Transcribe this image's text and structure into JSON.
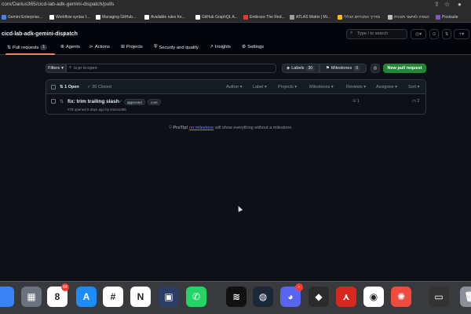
{
  "browser": {
    "url": "com/Darius365/cicd-lab-adk-gemini-dispatch/pulls",
    "bookmarks": [
      {
        "label": "Gemini Enterprise...",
        "color": "#4285f4"
      },
      {
        "label": "Workflow syntax f...",
        "color": "#ffffff"
      },
      {
        "label": "Managing GitHub...",
        "color": "#ffffff"
      },
      {
        "label": "Available rules for...",
        "color": "#ffffff"
      },
      {
        "label": "GitHub GraphQL A...",
        "color": "#ffffff"
      },
      {
        "label": "Embrace The Red...",
        "color": "#e53935"
      },
      {
        "label": "ATLAS Matrix | Mi...",
        "color": "#9e9e9e"
      },
      {
        "label": "מדריך המכרזים הכללי",
        "color": "#fbbc04"
      },
      {
        "label": "הנגדה לאישור תוכנית",
        "color": "#bdbdbd"
      },
      {
        "label": "Postsuite",
        "color": "#7e57c2"
      }
    ]
  },
  "repo": {
    "name": "cicd-lab-adk-gemini-dispatch"
  },
  "header": {
    "search_placeholder": "Type / to search",
    "plus_label": "+"
  },
  "nav": {
    "tabs": [
      {
        "label": "Pull requests",
        "count": "1"
      },
      {
        "label": "Agents"
      },
      {
        "label": "Actions"
      },
      {
        "label": "Projects"
      },
      {
        "label": "Security and quality"
      },
      {
        "label": "Insights"
      },
      {
        "label": "Settings"
      }
    ]
  },
  "filter_bar": {
    "filters_label": "Filters",
    "query": "is:pr is:open",
    "labels_label": "Labels",
    "labels_count": "30",
    "milestones_label": "Milestones",
    "milestones_count": "0",
    "new_pr_label": "New pull request"
  },
  "list": {
    "open_label": "1 Open",
    "closed_label": "30 Closed",
    "sort_menus": [
      "Author",
      "Label",
      "Projects",
      "Milestones",
      "Reviews",
      "Assignee",
      "Sort"
    ],
    "items": [
      {
        "title": "fix: trim trailing slash",
        "labels": [
          "approved",
          "core"
        ],
        "meta": "#78 opened 5 days ago by Darius365",
        "comments": "1",
        "review_count": "2"
      }
    ]
  },
  "protip": {
    "prefix": "ProTip!",
    "link": "no:milestone",
    "suffix": "will show everything without a milestone."
  },
  "dock": {
    "apps": [
      {
        "name": "finder",
        "color": "#3b82f6",
        "glyph": ""
      },
      {
        "name": "launchpad",
        "color": "#6b7280",
        "glyph": "▦"
      },
      {
        "name": "calendar",
        "color": "#ffffff",
        "glyph": "8"
      },
      {
        "name": "app-store",
        "color": "#1d8cf8",
        "glyph": "A"
      },
      {
        "name": "slack",
        "color": "#ffffff",
        "glyph": "#"
      },
      {
        "name": "notion",
        "color": "#ffffff",
        "glyph": "N"
      },
      {
        "name": "preview",
        "color": "#2c3e66",
        "glyph": "▣"
      },
      {
        "name": "whatsapp",
        "color": "#25d366",
        "glyph": "✆"
      },
      {
        "name": "spotify",
        "color": "#111111",
        "glyph": "≋"
      },
      {
        "name": "steam",
        "color": "#1b2838",
        "glyph": "◍"
      },
      {
        "name": "discord",
        "color": "#5865f2",
        "glyph": "◕"
      },
      {
        "name": "cube-app",
        "color": "#2b2b2b",
        "glyph": "◆"
      },
      {
        "name": "acrobat",
        "color": "#d6281e",
        "glyph": "⋏"
      },
      {
        "name": "chrome",
        "color": "#ffffff",
        "glyph": "◉"
      },
      {
        "name": "spark",
        "color": "#ef4b3f",
        "glyph": "✺"
      },
      {
        "name": "screen",
        "color": "#333333",
        "glyph": "▭"
      },
      {
        "name": "trash",
        "color": "#8a8f98",
        "glyph": "🗑"
      }
    ],
    "calendar_badge": "64",
    "discord_badge": "•"
  }
}
